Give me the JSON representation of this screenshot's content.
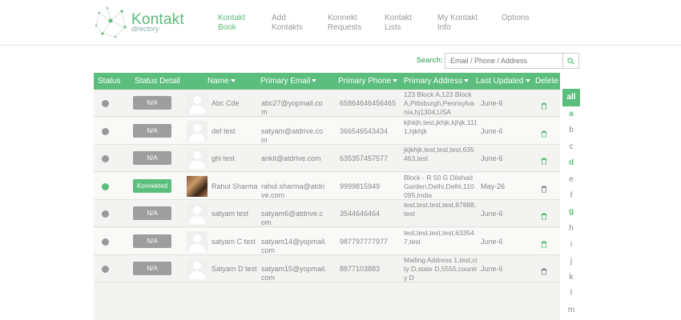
{
  "brand": {
    "name": "Kontakt",
    "subtitle": "directory"
  },
  "nav": [
    {
      "line1": "Kontakt",
      "line2": "Book",
      "active": true
    },
    {
      "line1": "Add",
      "line2": "Kontakts",
      "active": false
    },
    {
      "line1": "Konnekt",
      "line2": "Requests",
      "active": false
    },
    {
      "line1": "Kontakt",
      "line2": "Lists",
      "active": false
    },
    {
      "line1": "My Kontakt",
      "line2": "Info",
      "active": false
    },
    {
      "line1": "Options",
      "line2": "",
      "active": false
    }
  ],
  "search": {
    "label": "Search:",
    "placeholder": "Email / Phone / Address",
    "icon": "search-icon"
  },
  "table": {
    "headers": {
      "status": "Status",
      "status_detail": "Status Detail",
      "name": "Name",
      "email": "Primary Email",
      "phone": "Primary Phone",
      "address": "Primary Address",
      "updated": "Last Updated",
      "delete": "Delete"
    },
    "rows": [
      {
        "status": "offline",
        "detail": "N/A",
        "avatar": "placeholder",
        "name": "Abc Cde",
        "email": "abc27@yopmail.com",
        "phone": "65864646456465",
        "address": "123 Block A,123 Block A,Pittsburgh,Pennsylvania,hj1304,USA",
        "updated": "June-6",
        "trash_color": "#5cbe7c"
      },
      {
        "status": "offline",
        "detail": "N/A",
        "avatar": "placeholder",
        "name": "def test",
        "email": "satyam@atdrive.com",
        "phone": "366546543434",
        "address": "kjhkjh,test,jkhjk,kjhjk,1111,hjkhjk",
        "updated": "June-6",
        "trash_color": "#5cbe7c"
      },
      {
        "status": "offline",
        "detail": "N/A",
        "avatar": "placeholder",
        "name": "ghi test",
        "email": "ankit@atdrive.com",
        "phone": "635357457577",
        "address": "jkjkhjk,test,test,test,635463,test",
        "updated": "June-6",
        "trash_color": "#5cbe7c"
      },
      {
        "status": "online",
        "detail": "Konnekted",
        "avatar": "photo",
        "name": "Rahul Sharma",
        "email": "rahul.sharma@atdrive.com",
        "phone": "9999815949",
        "address": "Block - R 50 G Dilshad Garden,Delhi,Delhi,110095,India",
        "updated": "May-26",
        "trash_color": "#888888"
      },
      {
        "status": "offline",
        "detail": "N/A",
        "avatar": "placeholder",
        "name": "satyam test",
        "email": "satyam6@atdrive.com",
        "phone": "3544646464",
        "address": "test,test,test,test,87888,test",
        "updated": "June-6",
        "trash_color": "#5cbe7c"
      },
      {
        "status": "offline",
        "detail": "N/A",
        "avatar": "placeholder",
        "name": "satyam C test",
        "email": "satyam14@yopmail.com",
        "phone": "987797777977",
        "address": "test,test,test,test,633547,test",
        "updated": "June-6",
        "trash_color": "#5cbe7c"
      },
      {
        "status": "offline",
        "detail": "N/A",
        "avatar": "placeholder",
        "name": "Satyam D test",
        "email": "satyam15@yopmail.com",
        "phone": "8877103883",
        "address": "Mailing Address 1,test,city D,state D,5555,country D",
        "updated": "June-6",
        "trash_color": "#888888"
      }
    ]
  },
  "alphabet": [
    {
      "letter": "all",
      "state": "active"
    },
    {
      "letter": "a",
      "state": "has"
    },
    {
      "letter": "b",
      "state": "none"
    },
    {
      "letter": "c",
      "state": "none"
    },
    {
      "letter": "d",
      "state": "has"
    },
    {
      "letter": "e",
      "state": "none"
    },
    {
      "letter": "f",
      "state": "none"
    },
    {
      "letter": "g",
      "state": "has"
    },
    {
      "letter": "h",
      "state": "none"
    },
    {
      "letter": "i",
      "state": "none"
    },
    {
      "letter": "j",
      "state": "none"
    },
    {
      "letter": "k",
      "state": "none"
    },
    {
      "letter": "l",
      "state": "none"
    },
    {
      "letter": "m",
      "state": "none"
    }
  ],
  "colors": {
    "accent": "#5cbe7c",
    "badge_gray": "#9e9e9e",
    "dot_offline": "#999999"
  }
}
